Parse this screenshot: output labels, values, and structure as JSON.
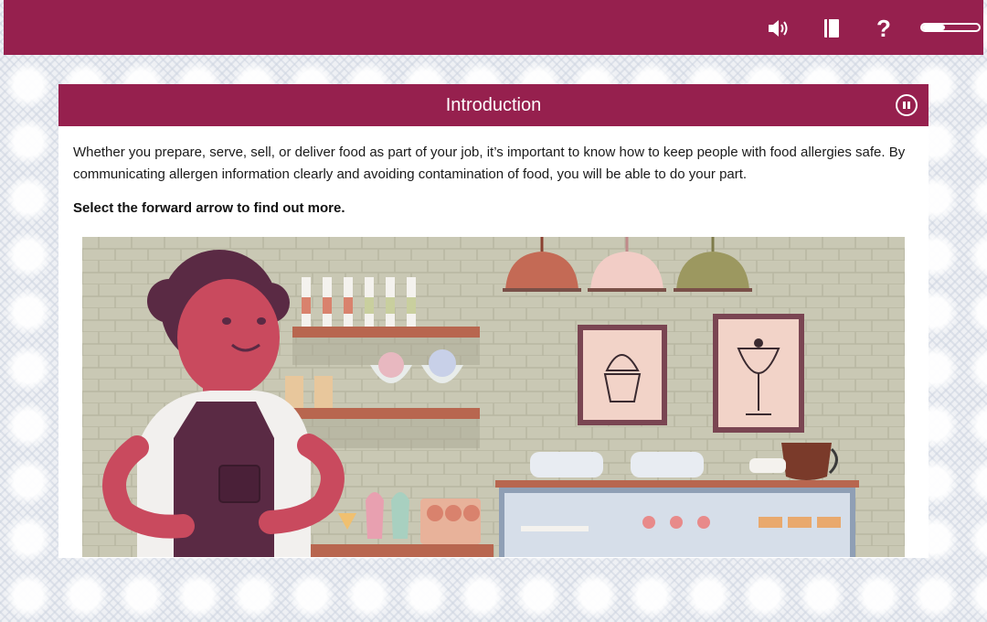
{
  "topbar": {
    "icons": [
      "audio-icon",
      "glossary-book-icon",
      "help-icon"
    ],
    "help_label": "?",
    "progress_fraction": 0.4
  },
  "panel": {
    "title": "Introduction",
    "body": "Whether you prepare, serve, sell, or deliver food as part of your job, it’s important to know how to keep people with food allergies safe. By communicating allergen information clearly and avoiding contamination of food, you will be able to do your part.",
    "instruction": "Select the forward arrow to find out more.",
    "illustration": "cafe-counter-illustration"
  },
  "colors": {
    "brand": "#96204e",
    "background": "#eef0f4",
    "panel": "#ffffff"
  }
}
